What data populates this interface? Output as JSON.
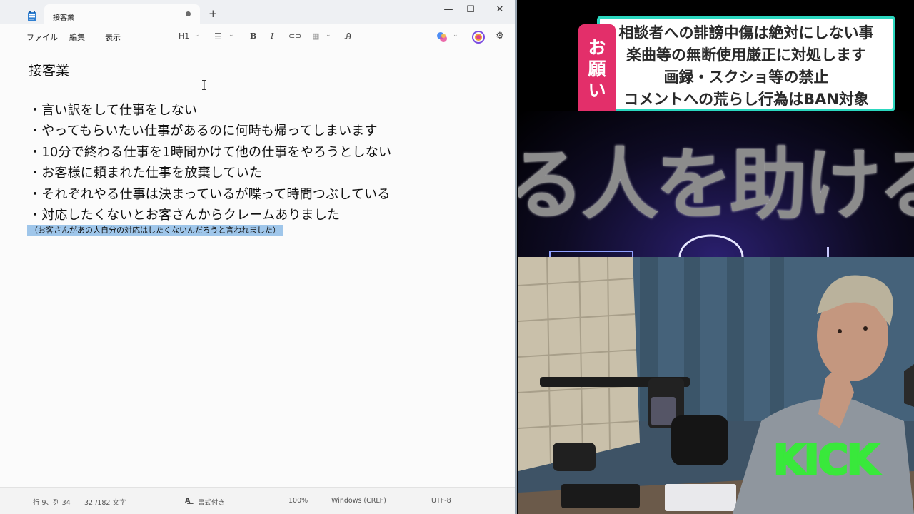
{
  "window": {
    "tab_title": "接客業",
    "new_tab_icon": "plus-icon",
    "controls": [
      "minimize-icon",
      "maximize-icon",
      "close-icon"
    ]
  },
  "menu": {
    "file": "ファイル",
    "edit": "編集",
    "view": "表示"
  },
  "toolbar": {
    "heading": "H1",
    "icons": [
      "list-icon",
      "bold-icon",
      "italic-icon",
      "link-icon",
      "table-icon",
      "clear-format-icon",
      "copilot-icon",
      "account-icon",
      "gear-icon"
    ]
  },
  "document": {
    "title": "接客業",
    "bullets": [
      "・言い訳をして仕事をしない",
      "・やってもらいたい仕事があるのに何時も帰ってしまいます",
      "・10分で終わる仕事を1時間かけて他の仕事をやろうとしない",
      "・お客様に頼まれた仕事を放棄していた",
      "・それぞれやる仕事は決まっているが喋って時間つぶしている",
      "・対応したくないとお客さんからクレームありました"
    ],
    "selected_note": "（お客さんがあの人自分の対応はしたくないんだろうと言われました）"
  },
  "status": {
    "position": "行 9、列 34",
    "char_count": "32 /182 文字",
    "format": "書式付き",
    "zoom": "100%",
    "line_ending": "Windows (CRLF)",
    "encoding": "UTF-8"
  },
  "notice": {
    "tag": [
      "お",
      "願",
      "い"
    ],
    "lines": [
      "相談者への誹謗中傷は絶対にしない事",
      "楽曲等の無断使用厳正に対処します",
      "画録・スクショ等の禁止",
      "コメントへの荒らし行為はBAN対象"
    ]
  },
  "banner": {
    "text": "る人を助ける"
  },
  "kick": {
    "label": "KICK"
  },
  "colors": {
    "notice_border": "#2bd7bf",
    "notice_tag": "#e32f6a",
    "kick_green": "#39e83b",
    "selection": "#9fc6ea"
  }
}
